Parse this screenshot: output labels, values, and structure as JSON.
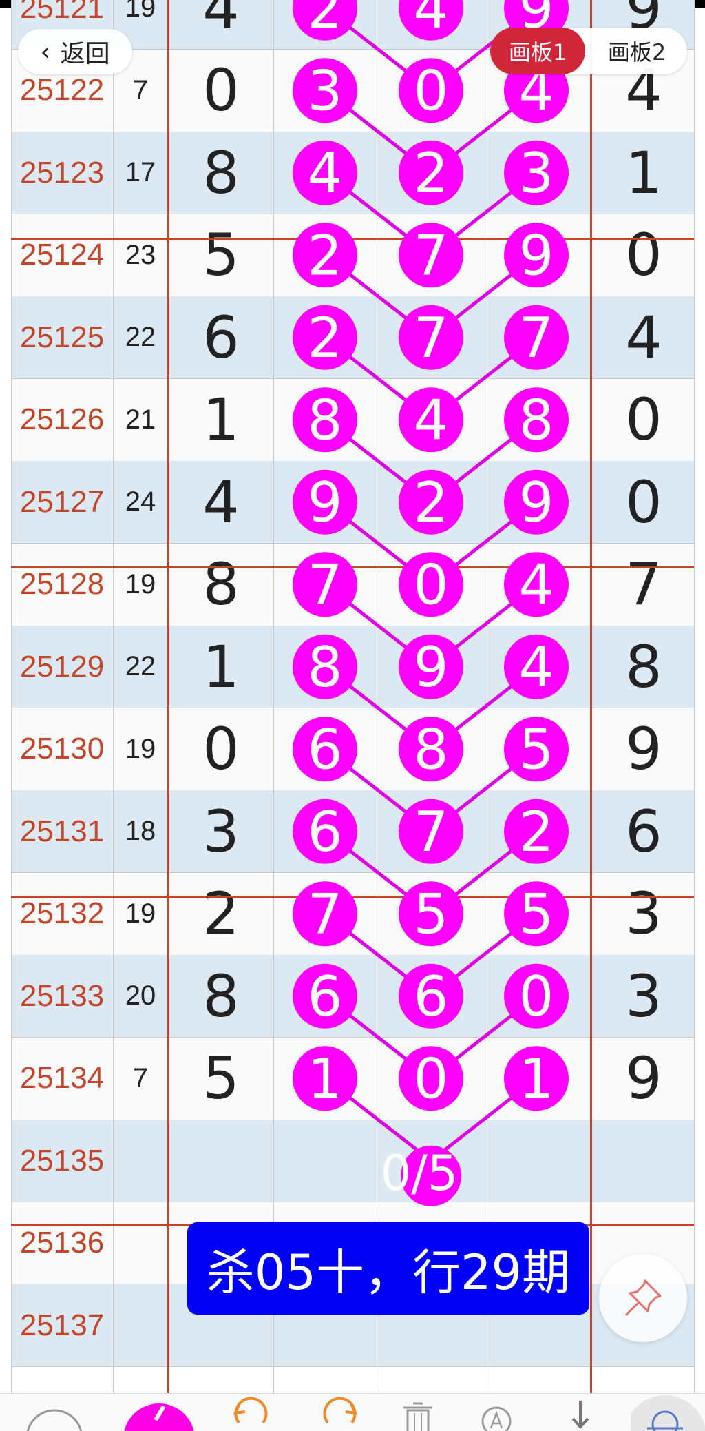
{
  "nav": {
    "back_label": "返回",
    "tabs": [
      {
        "label": "画板1",
        "active": true
      },
      {
        "label": "画板2",
        "active": false
      }
    ]
  },
  "rows": [
    {
      "issue": "25121",
      "sum": "19",
      "first": "4",
      "balls": [
        "2",
        "4",
        "9"
      ],
      "last": "9"
    },
    {
      "issue": "25122",
      "sum": "7",
      "first": "0",
      "balls": [
        "3",
        "0",
        "4"
      ],
      "last": "4"
    },
    {
      "issue": "25123",
      "sum": "17",
      "first": "8",
      "balls": [
        "4",
        "2",
        "3"
      ],
      "last": "1"
    },
    {
      "issue": "25124",
      "sum": "23",
      "first": "5",
      "balls": [
        "2",
        "7",
        "9"
      ],
      "last": "0"
    },
    {
      "issue": "25125",
      "sum": "22",
      "first": "6",
      "balls": [
        "2",
        "7",
        "7"
      ],
      "last": "4"
    },
    {
      "issue": "25126",
      "sum": "21",
      "first": "1",
      "balls": [
        "8",
        "4",
        "8"
      ],
      "last": "0"
    },
    {
      "issue": "25127",
      "sum": "24",
      "first": "4",
      "balls": [
        "9",
        "2",
        "9"
      ],
      "last": "0"
    },
    {
      "issue": "25128",
      "sum": "19",
      "first": "8",
      "balls": [
        "7",
        "0",
        "4"
      ],
      "last": "7"
    },
    {
      "issue": "25129",
      "sum": "22",
      "first": "1",
      "balls": [
        "8",
        "9",
        "4"
      ],
      "last": "8"
    },
    {
      "issue": "25130",
      "sum": "19",
      "first": "0",
      "balls": [
        "6",
        "8",
        "5"
      ],
      "last": "9"
    },
    {
      "issue": "25131",
      "sum": "18",
      "first": "3",
      "balls": [
        "6",
        "7",
        "2"
      ],
      "last": "6"
    },
    {
      "issue": "25132",
      "sum": "19",
      "first": "2",
      "balls": [
        "7",
        "5",
        "5"
      ],
      "last": "3"
    },
    {
      "issue": "25133",
      "sum": "20",
      "first": "8",
      "balls": [
        "6",
        "6",
        "0"
      ],
      "last": "3"
    },
    {
      "issue": "25134",
      "sum": "7",
      "first": "5",
      "balls": [
        "1",
        "0",
        "1"
      ],
      "last": "9"
    },
    {
      "issue": "25135",
      "sum": "",
      "first": "",
      "balls": [],
      "last": ""
    },
    {
      "issue": "25136",
      "sum": "",
      "first": "",
      "balls": [],
      "last": ""
    },
    {
      "issue": "25137",
      "sum": "",
      "first": "",
      "balls": [],
      "last": ""
    }
  ],
  "prediction_text": "0/5",
  "banner_text": "杀05十，行29期",
  "colors": {
    "ball": "#ff00ff",
    "line": "#e000e6",
    "issue": "#c5452a",
    "banner": "#0000f5",
    "active_tab": "#d0263a"
  },
  "toolbar_icons": [
    "link-icon",
    "pen-icon",
    "undo-icon",
    "redo-icon",
    "trash-icon",
    "text-icon",
    "download-icon",
    "settings-icon"
  ]
}
